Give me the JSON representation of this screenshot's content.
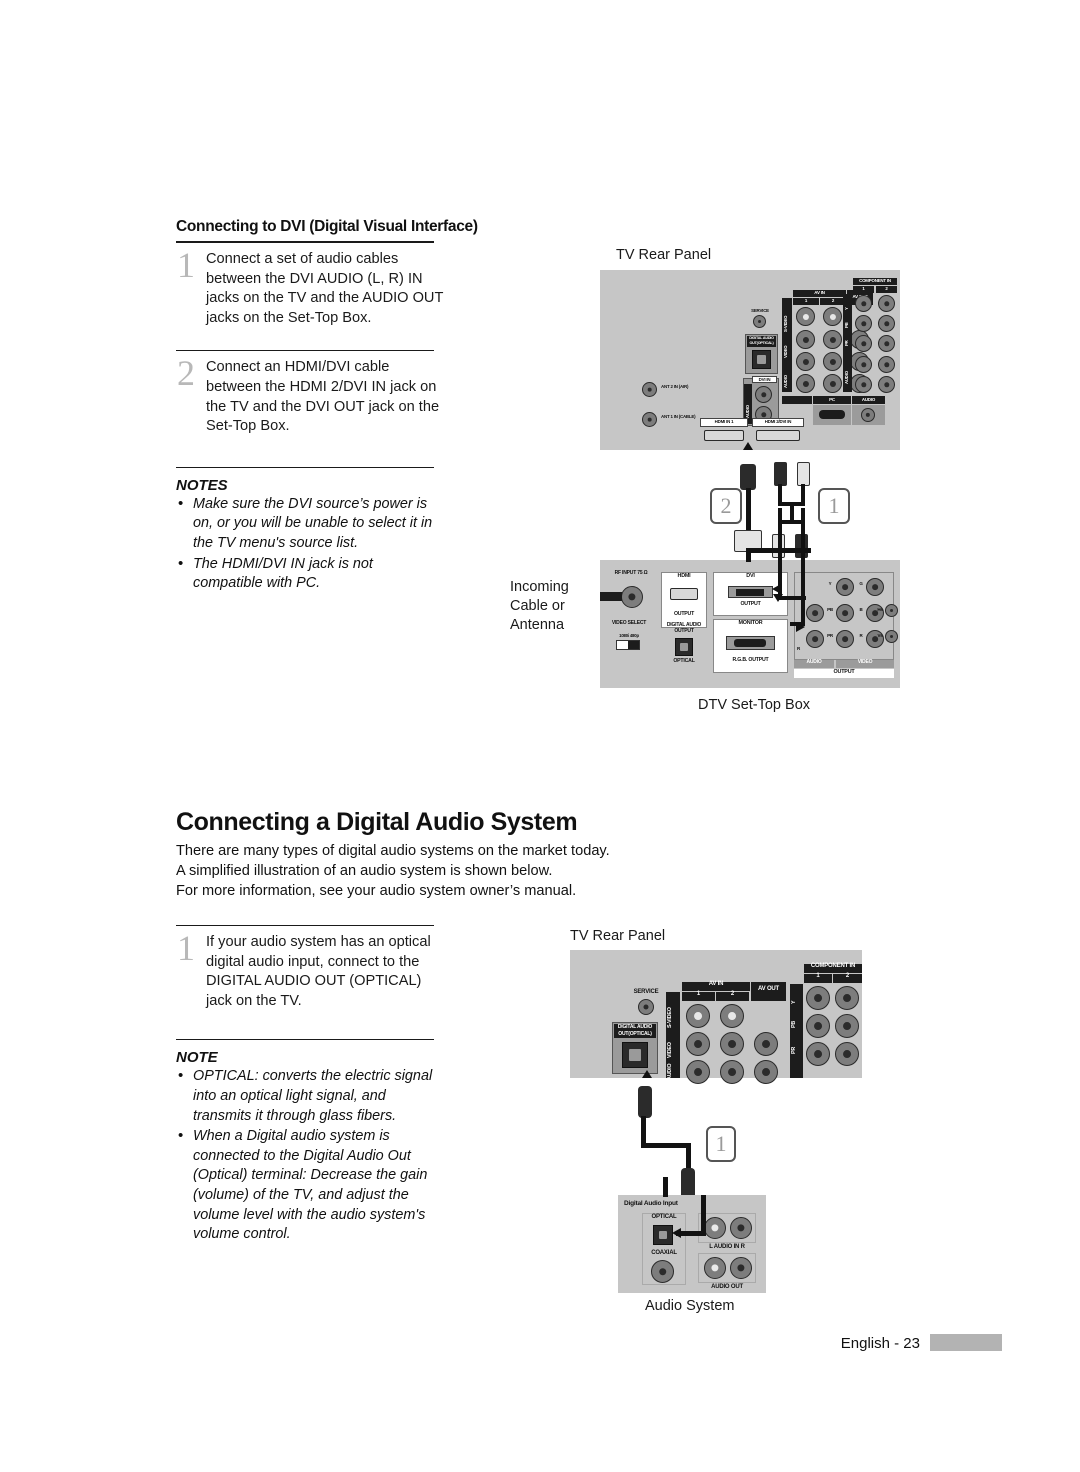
{
  "page": {
    "footer_text": "English - 23"
  },
  "section1": {
    "heading": "Connecting to DVI (Digital Visual Interface)",
    "steps": [
      {
        "number": "1",
        "text": "Connect a set of audio cables between the DVI AUDIO (L, R) IN jacks on the TV and the AUDIO OUT jacks on the Set-Top Box."
      },
      {
        "number": "2",
        "text": "Connect an HDMI/DVI cable between the HDMI 2/DVI IN jack on the TV and the DVI OUT jack on the Set-Top Box."
      }
    ],
    "notes_heading": "NOTES",
    "notes": [
      "Make sure the DVI source’s power is on, or you will be unable to select it in the TV menu's source list.",
      "The HDMI/DVI IN jack is not compatible with PC."
    ],
    "diagram": {
      "top_caption": "TV Rear Panel",
      "bottom_caption": "DTV Set-Top Box",
      "incoming_label": "Incoming\nCable or\nAntenna",
      "callouts": [
        "2",
        "1"
      ],
      "tv_panel_labels": {
        "service": "SERVICE",
        "digital_audio_out": "DIGITAL AUDIO OUT(OPTICAL)",
        "ant2": "ANT 2 IN (AIR)",
        "ant1": "ANT 1 IN (CABLE)",
        "hdmi_in1": "HDMI IN 1",
        "hdmi2_dvi_in": "HDMI 2/DVI IN",
        "dvi_in": "DVI IN",
        "av_in": "AV IN",
        "av_in_1": "1",
        "av_in_2": "2",
        "av_out": "AV OUT",
        "s_video": "S-VIDEO",
        "video": "VIDEO",
        "audio": "AUDIO",
        "audio_l": "L",
        "audio_r": "R",
        "component_in": "COMPONENT IN",
        "component_1": "1",
        "component_2": "2",
        "y": "Y",
        "pb": "PB",
        "pr": "PR",
        "pc": "PC",
        "pc_audio": "AUDIO"
      },
      "stb_labels": {
        "rf_input": "RF INPUT 75 Ω",
        "video_select": "VIDEO SELECT",
        "video_select_opts": "1080i  480p",
        "hdmi": "HDMI",
        "hdmi_output": "OUTPUT",
        "digital_audio_output": "DIGITAL AUDIO OUTPUT",
        "optical": "OPTICAL",
        "dvi": "DVI",
        "dvi_output": "OUTPUT",
        "monitor": "MONITOR",
        "rgb_output": "R.G.B. OUTPUT",
        "audio": "AUDIO",
        "video": "VIDEO",
        "output": "OUTPUT",
        "audio_l": "L",
        "audio_r": "R",
        "y": "Y",
        "pb": "PB",
        "pr": "PR",
        "g": "G",
        "b": "B",
        "r": "R",
        "hs": "Hs",
        "vs": "Vs"
      }
    }
  },
  "section2": {
    "heading": "Connecting a Digital Audio System",
    "intro": "There are many types of digital audio systems on the market today.\nA simplified illustration of an audio system is shown below.\nFor more information, see your audio system owner’s manual.",
    "steps": [
      {
        "number": "1",
        "text": "If your audio system has an optical digital audio input, connect to the DIGITAL AUDIO OUT (OPTICAL) jack on the TV."
      }
    ],
    "notes_heading": "NOTE",
    "notes": [
      "OPTICAL: converts the electric signal into an optical light signal, and transmits it through glass fibers.",
      "When a Digital audio system is connected to the Digital Audio Out (Optical) terminal: Decrease the gain (volume) of the TV, and adjust the volume level with the audio system's volume control."
    ],
    "diagram": {
      "top_caption": "TV Rear Panel",
      "bottom_caption": "Audio System",
      "callouts": [
        "1"
      ],
      "tv_panel_labels": {
        "service": "SERVICE",
        "digital_audio_out": "DIGITAL AUDIO OUT(OPTICAL)",
        "av_in": "AV IN",
        "av_in_1": "1",
        "av_in_2": "2",
        "av_out": "AV OUT",
        "s_video": "S-VIDEO",
        "video": "VIDEO",
        "audio": "AUDIO",
        "component_in": "COMPONENT IN",
        "component_1": "1",
        "component_2": "2",
        "y": "Y",
        "pb": "PB",
        "pr": "PR"
      },
      "audio_system_labels": {
        "digital_audio_input": "Digital Audio Input",
        "optical": "OPTICAL",
        "coaxial": "COAXIAL",
        "audio_in": "L  AUDIO IN  R",
        "audio_out": "AUDIO OUT"
      }
    }
  }
}
